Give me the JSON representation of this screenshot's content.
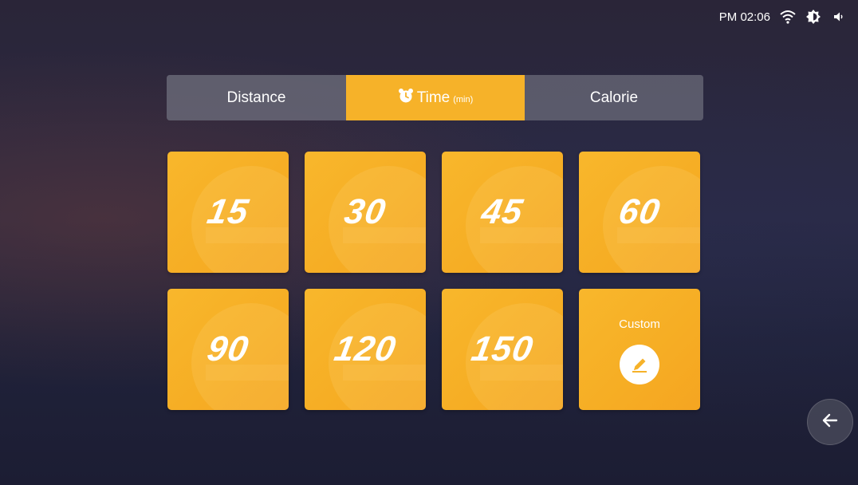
{
  "status_bar": {
    "time": "PM 02:06",
    "icons": [
      "wifi-icon",
      "brightness-icon",
      "volume-icon"
    ]
  },
  "tabs": [
    {
      "label": "Distance",
      "unit": "",
      "selected": false
    },
    {
      "label": "Time",
      "unit": "(min)",
      "selected": true,
      "icon": "alarm-clock-icon"
    },
    {
      "label": "Calorie",
      "unit": "",
      "selected": false
    }
  ],
  "tiles": {
    "t0": "15",
    "t1": "30",
    "t2": "45",
    "t3": "60",
    "t4": "90",
    "t5": "120",
    "t6": "150"
  },
  "custom_tile": {
    "label": "Custom",
    "icon": "edit-pencil-icon"
  },
  "back_button": {
    "icon": "arrow-left-icon"
  },
  "colors": {
    "accent": "#f6b229",
    "tab_inactive": "#6a6a78",
    "background": "#2a2840"
  }
}
